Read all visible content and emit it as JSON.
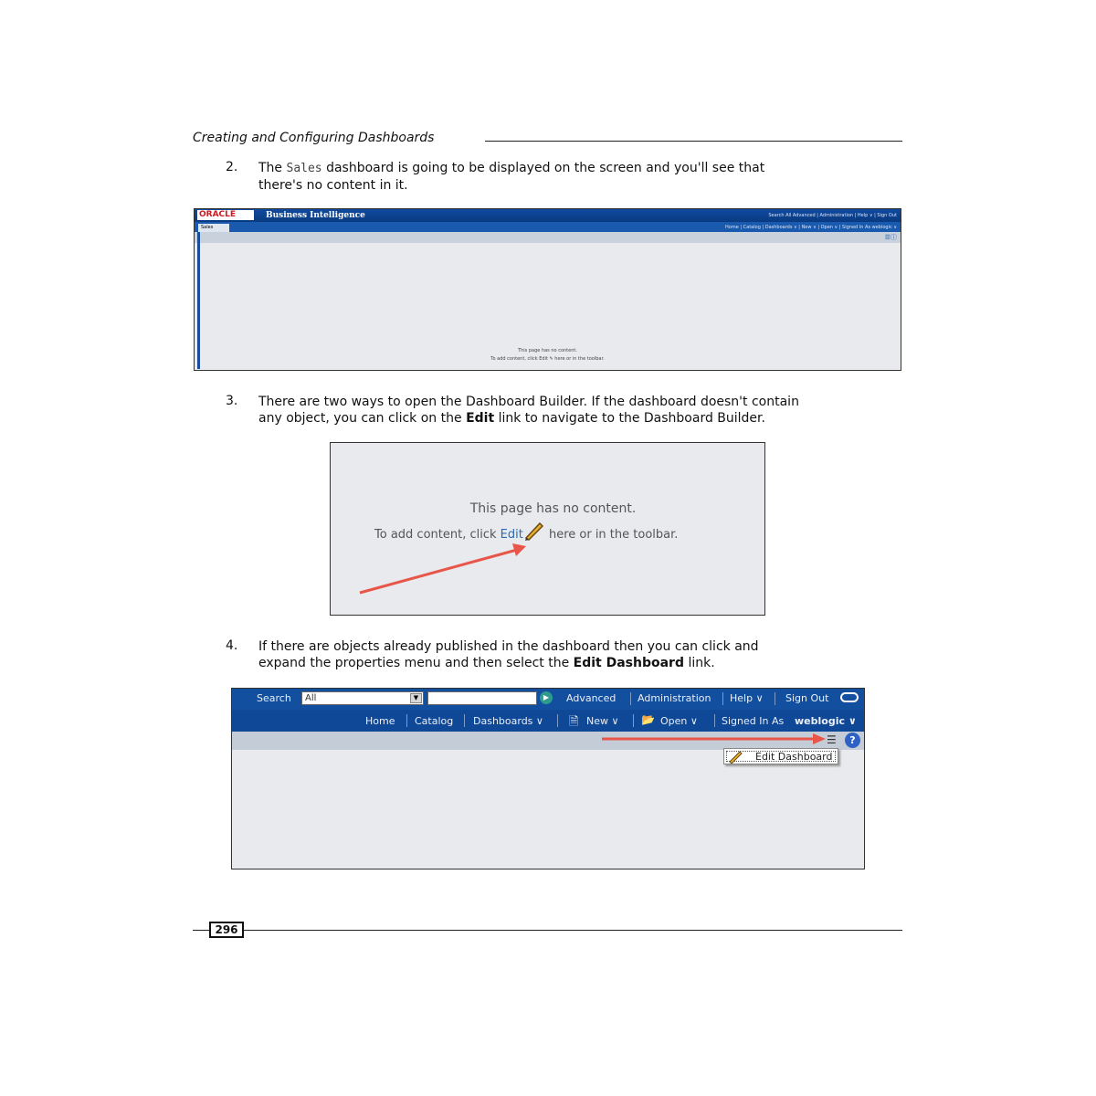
{
  "header": {
    "title": "Creating and Configuring Dashboards"
  },
  "steps": [
    {
      "num": "2.",
      "pre": "The ",
      "code": "Sales",
      "post_line1": " dashboard is going to be displayed on the screen and you'll see that",
      "line2": "there's no content in it."
    },
    {
      "num": "3.",
      "line1": "There are two ways to open the Dashboard Builder. If the dashboard doesn't contain",
      "pre2": "any object, you can click on the ",
      "bold": "Edit",
      "post2": " link to navigate to the Dashboard Builder."
    },
    {
      "num": "4.",
      "line1": "If there are objects already published in the dashboard then you can click and",
      "pre2": "expand the properties menu and then select the ",
      "bold": "Edit Dashboard",
      "post2": " link."
    }
  ],
  "screenshot1": {
    "logo": "ORACLE",
    "product": "Business Intelligence",
    "top_right": "Search  All                           Advanced  |  Administration  |  Help ∨  |  Sign Out",
    "tab": "Sales",
    "row2_right": "Home  |  Catalog  |  Dashboards ∨  |  New ∨  |  Open ∨  |  Signed In As  weblogic ∨",
    "msg1": "This page has no content.",
    "msg2": "To add content, click Edit ✎ here or in the toolbar."
  },
  "screenshot2": {
    "line1": "This page has no content.",
    "line2_pre": "To add content, click ",
    "edit": "Edit",
    "line2_post": " here or in the toolbar."
  },
  "screenshot3": {
    "search_label": "Search",
    "search_scope": "All",
    "advanced": "Advanced",
    "administration": "Administration",
    "help": "Help ∨",
    "signout": "Sign Out",
    "home": "Home",
    "catalog": "Catalog",
    "dashboards": "Dashboards ∨",
    "new": "New ∨",
    "open": "Open ∨",
    "signed_in_as": "Signed In As",
    "user": "weblogic ∨",
    "menu_item": "Edit Dashboard"
  },
  "footer": {
    "page_number": "296"
  },
  "colors": {
    "oracle_blue": "#12509f",
    "arrow": "#e8564a",
    "oracle_red": "#d0181e"
  }
}
